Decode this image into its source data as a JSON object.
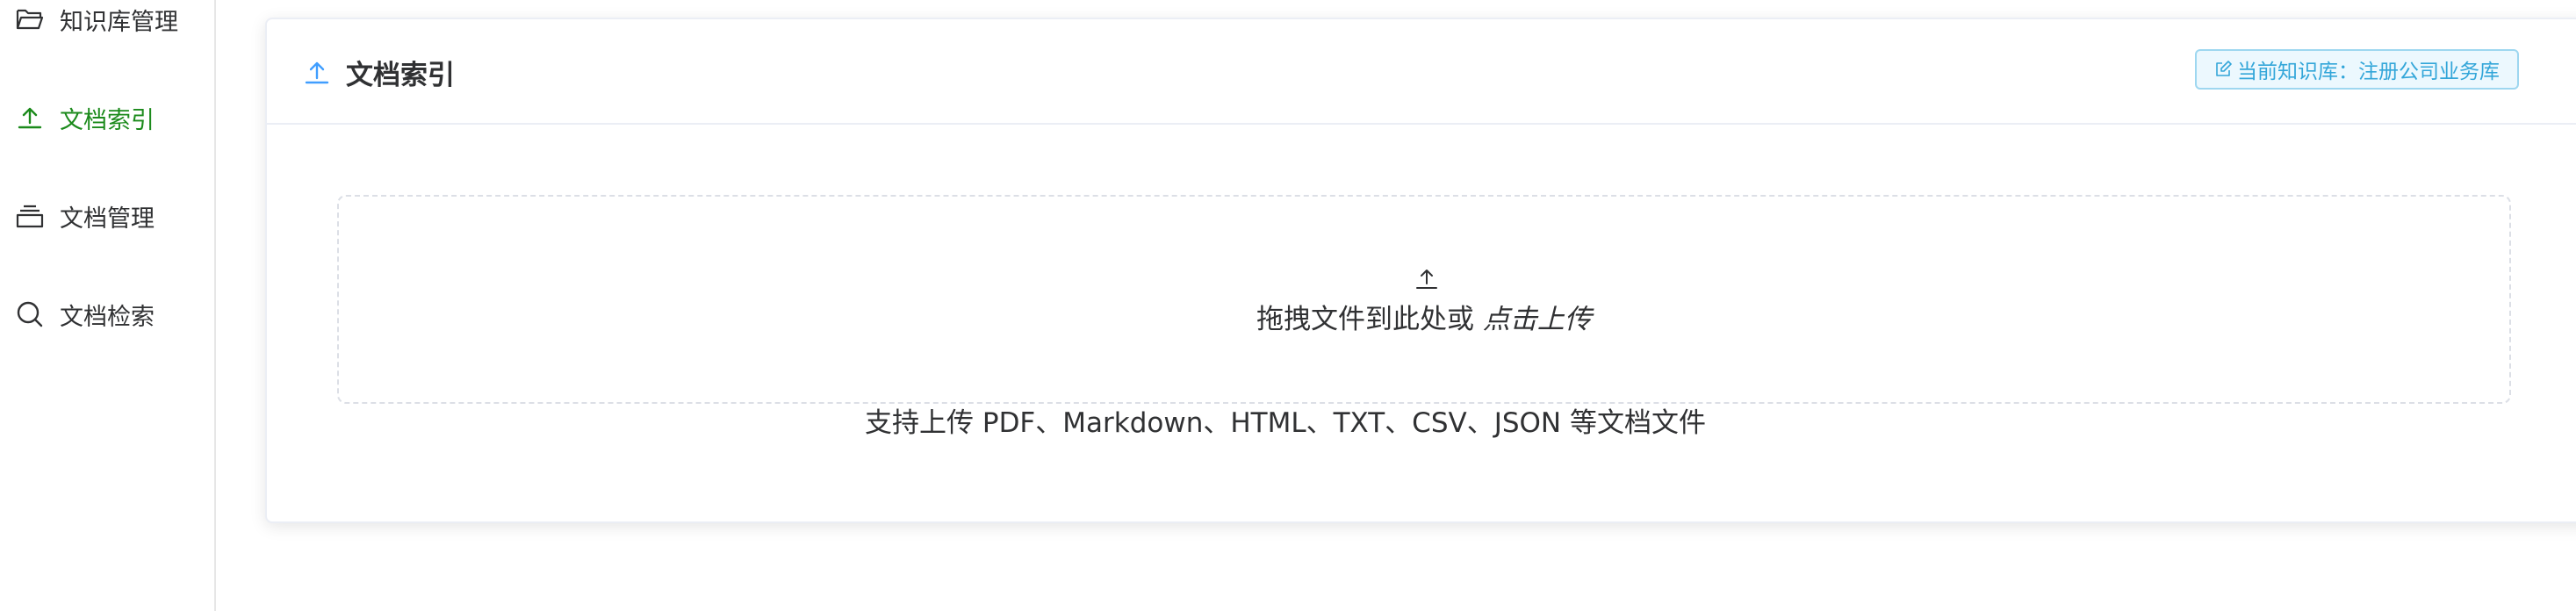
{
  "sidebar": {
    "items": [
      {
        "label": "知识库管理",
        "icon": "folder-open-icon",
        "active": false
      },
      {
        "label": "文档索引",
        "icon": "upload-icon",
        "active": true
      },
      {
        "label": "文档管理",
        "icon": "stack-icon",
        "active": false
      },
      {
        "label": "文档检索",
        "icon": "search-icon",
        "active": false
      }
    ]
  },
  "card": {
    "title": "文档索引",
    "title_icon": "upload-icon",
    "kb_tag": "当前知识库：注册公司业务库",
    "kb_tag_icon": "edit-icon"
  },
  "upload": {
    "text": "拖拽文件到此处或",
    "link": "点击上传",
    "tip": "支持上传 PDF、Markdown、HTML、TXT、CSV、JSON 等文档文件"
  },
  "colors": {
    "active": "#1b8a1b",
    "accent": "#409eff",
    "tag_text": "#33a6d9",
    "tag_bg": "#ecf8fe"
  }
}
